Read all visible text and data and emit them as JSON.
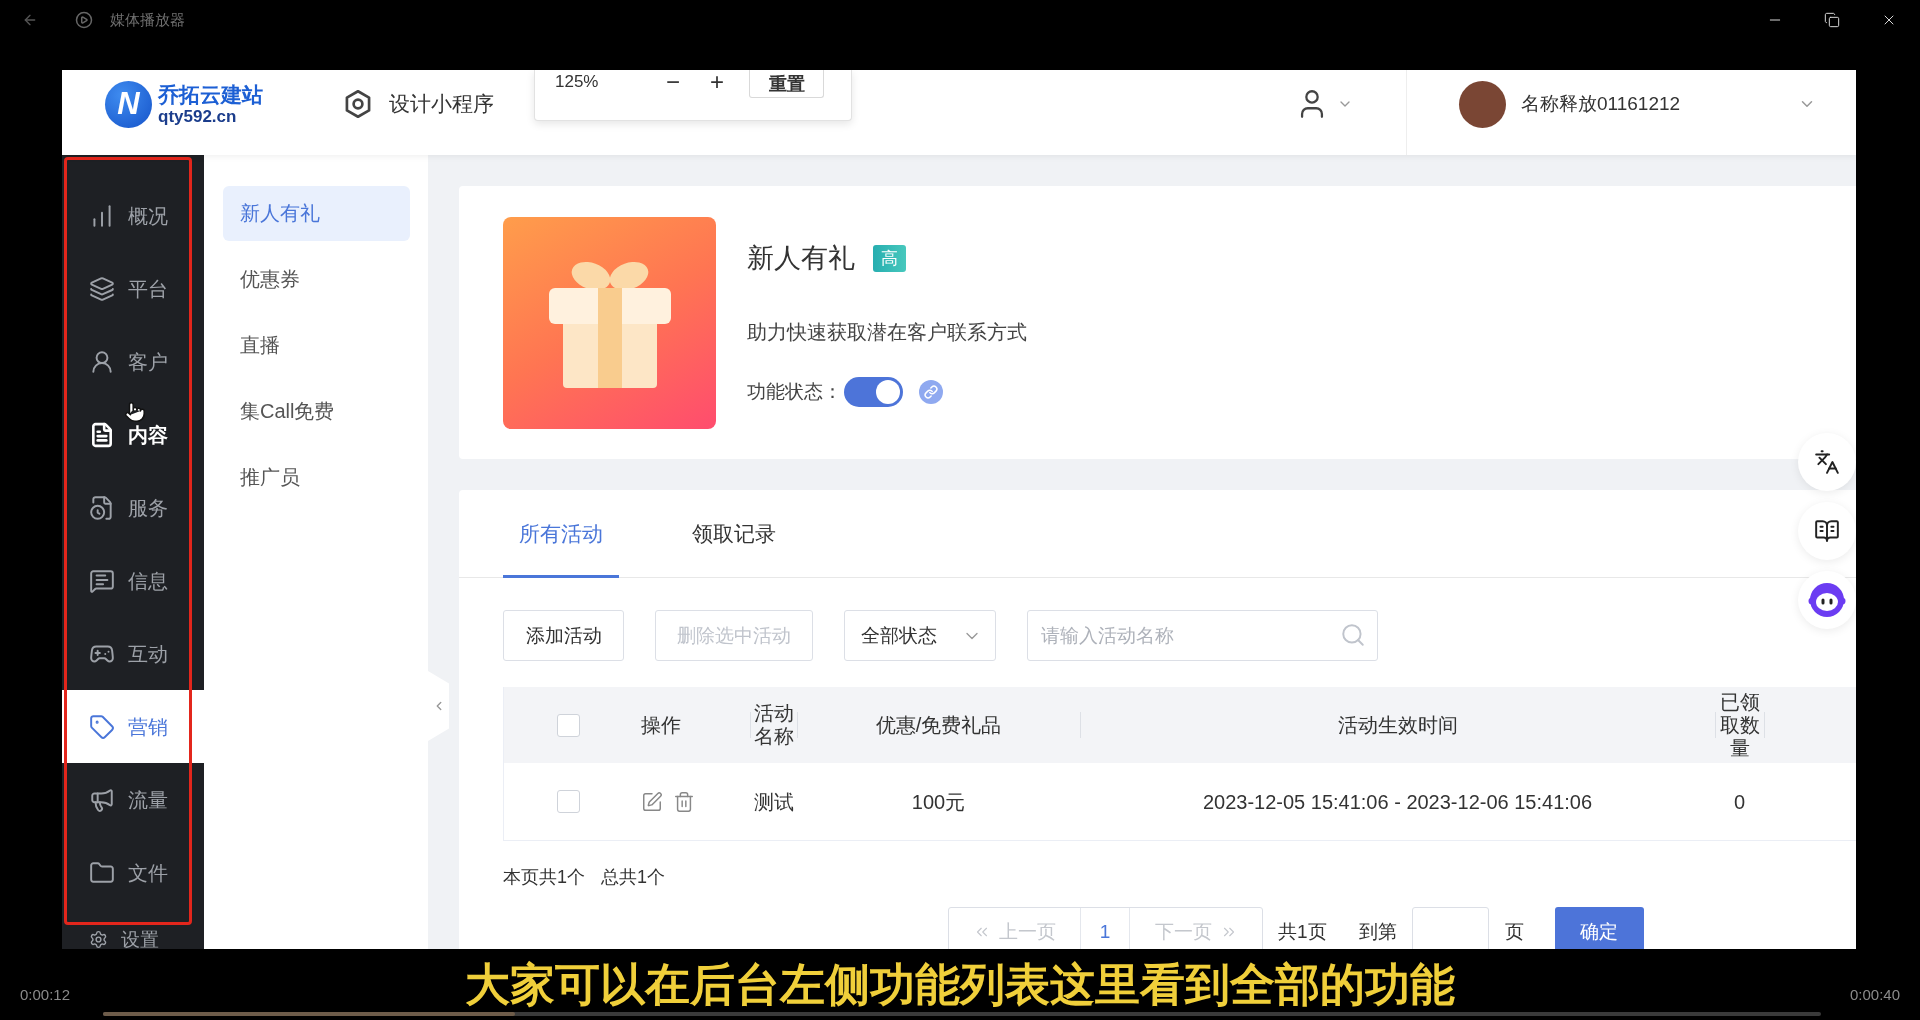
{
  "player": {
    "title": "媒体播放器",
    "subtitle": "大家可以在后台左侧功能列表这里看到全部的功能",
    "elapsed": "0:00:12",
    "duration": "0:00:40",
    "progress": {
      "level": 0.24
    }
  },
  "header": {
    "logo": {
      "mark": "N",
      "name": "乔拓云建站",
      "domain": "qty592.cn"
    },
    "design_link": "设计小程序",
    "zoom": {
      "value": "125%",
      "zoom_out": "−",
      "zoom_in": "+",
      "reset": "重置"
    },
    "account": {
      "name": "名称释放01161212"
    }
  },
  "sidebar": {
    "highlighted": true,
    "items": [
      {
        "label": "概况",
        "selected": false,
        "hovered": false
      },
      {
        "label": "平台",
        "selected": false,
        "hovered": false
      },
      {
        "label": "客户",
        "selected": false,
        "hovered": false
      },
      {
        "label": "内容",
        "selected": false,
        "hovered": true
      },
      {
        "label": "服务",
        "selected": false,
        "hovered": false
      },
      {
        "label": "信息",
        "selected": false,
        "hovered": false
      },
      {
        "label": "互动",
        "selected": false,
        "hovered": false
      },
      {
        "label": "营销",
        "selected": true,
        "hovered": false
      },
      {
        "label": "流量",
        "selected": false,
        "hovered": false
      },
      {
        "label": "文件",
        "selected": false,
        "hovered": false
      },
      {
        "label": "设置",
        "selected": false,
        "hovered": false
      }
    ]
  },
  "submenu": {
    "items": [
      {
        "label": "新人有礼",
        "selected": true
      },
      {
        "label": "优惠券",
        "selected": false
      },
      {
        "label": "直播",
        "selected": false
      },
      {
        "label": "集Call免费",
        "selected": false
      },
      {
        "label": "推广员",
        "selected": false
      }
    ]
  },
  "feature": {
    "title": "新人有礼",
    "badge": "高",
    "description": "助力快速获取潜在客户联系方式",
    "status_label": "功能状态：",
    "on": true
  },
  "tabs": [
    {
      "label": "所有活动",
      "selected": true
    },
    {
      "label": "领取记录",
      "selected": false
    }
  ],
  "toolbar": {
    "add_button": {
      "label": "添加活动",
      "disabled": false
    },
    "delete_button": {
      "label": "删除选中活动",
      "disabled": true
    },
    "status_filter": "全部状态",
    "search": {
      "placeholder": "请输入活动名称"
    }
  },
  "table": {
    "select_all": {
      "checked": false
    },
    "columns": [
      "操作",
      "活动名称",
      "优惠/免费礼品",
      "活动生效时间",
      "已领取数量"
    ],
    "rows": [
      {
        "checked": false,
        "name": "测试",
        "reward": "100元",
        "period": "2023-12-05 15:41:06 - 2023-12-06 15:41:06",
        "claimed": "0"
      }
    ]
  },
  "summary": {
    "page_count": "本页共1个",
    "total": "总共1个"
  },
  "pagination": {
    "prev": {
      "label": "上一页",
      "disabled": true
    },
    "pages": [
      {
        "label": "1",
        "selected": true
      }
    ],
    "next": {
      "label": "下一页",
      "disabled": true
    },
    "total_pages": "共1页",
    "goto_label": "到第",
    "goto_suffix": "页",
    "confirm": "确定"
  }
}
